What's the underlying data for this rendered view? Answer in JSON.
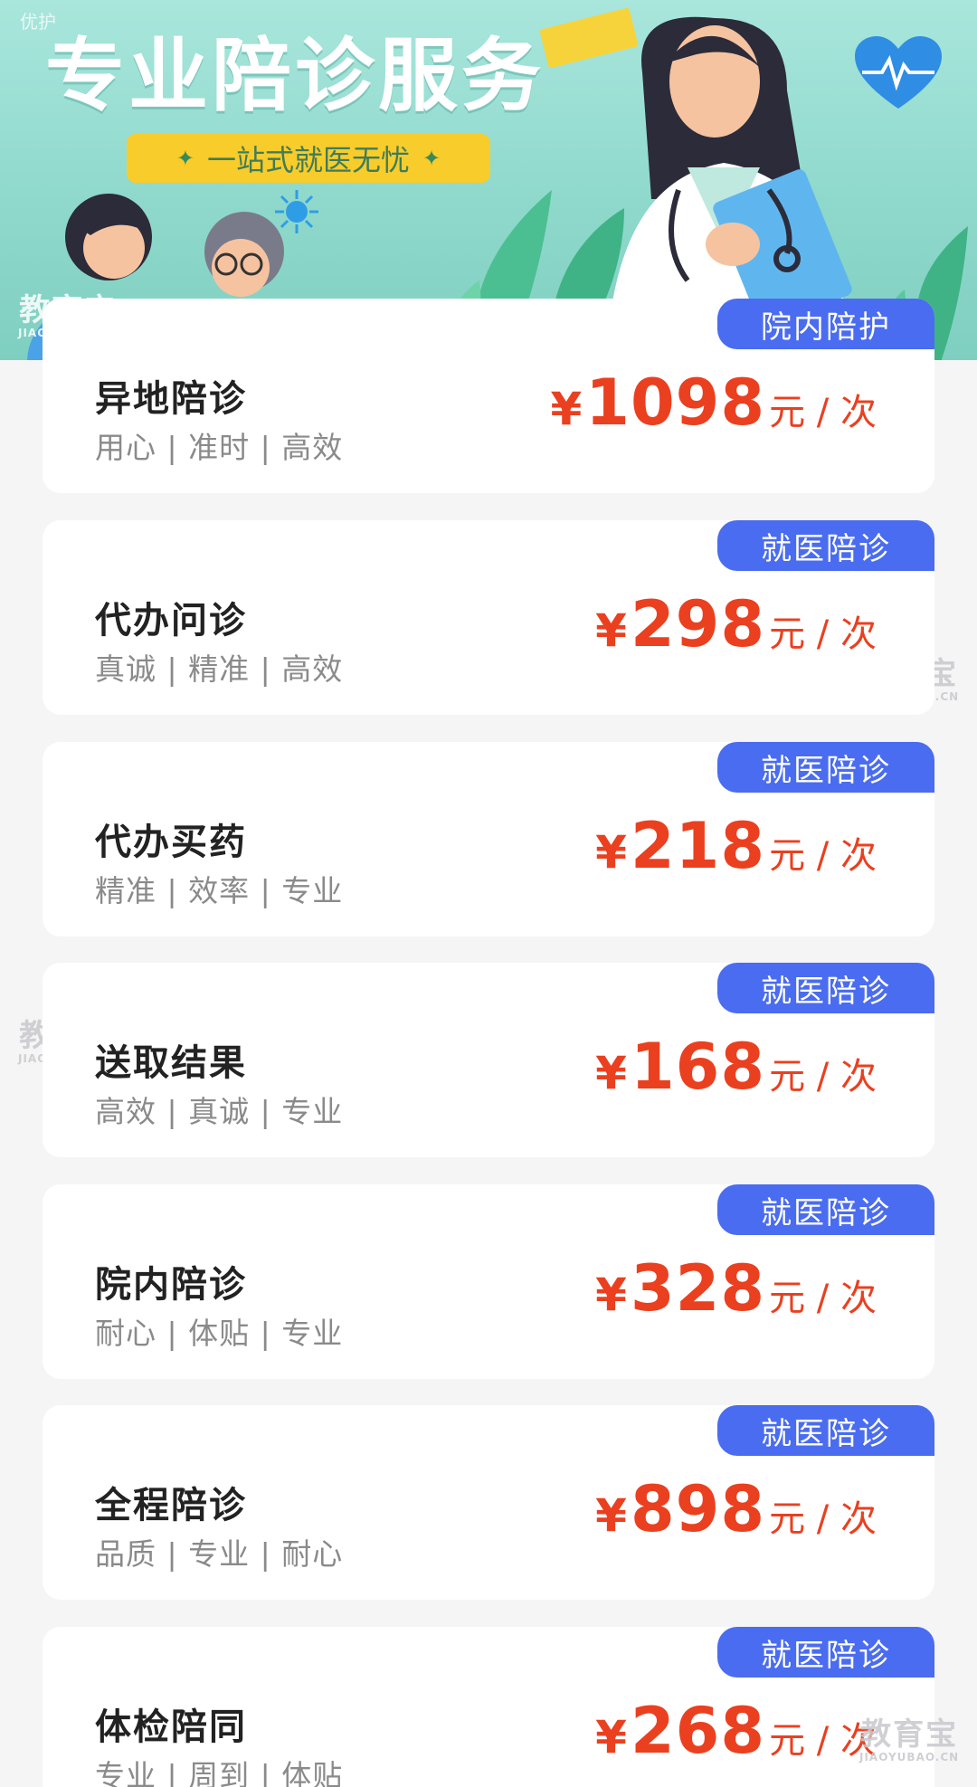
{
  "banner": {
    "corner_text": "优护",
    "title": "专业陪诊服务",
    "slogan": "一站式就医无忧",
    "colors": {
      "background": "#a9e6dc",
      "slogan_bg": "#f8cc2a",
      "heart": "#2f8de4"
    }
  },
  "watermark": {
    "main": "教育宝",
    "sub": "JIAOYUBAO.CN"
  },
  "price_prefix": "¥",
  "services": [
    {
      "name": "异地陪诊",
      "tags": "用心 | 准时 | 高效",
      "price": "1098",
      "unit": "元 / 次",
      "badge": "院内陪护"
    },
    {
      "name": "代办问诊",
      "tags": "真诚 | 精准 | 高效",
      "price": "298",
      "unit": "元 / 次",
      "badge": "就医陪诊"
    },
    {
      "name": "代办买药",
      "tags": "精准 | 效率 | 专业",
      "price": "218",
      "unit": "元 / 次",
      "badge": "就医陪诊"
    },
    {
      "name": "送取结果",
      "tags": "高效 | 真诚 | 专业",
      "price": "168",
      "unit": "元 / 次",
      "badge": "就医陪诊"
    },
    {
      "name": "院内陪诊",
      "tags": "耐心 | 体贴 | 专业",
      "price": "328",
      "unit": "元 / 次",
      "badge": "就医陪诊"
    },
    {
      "name": "全程陪诊",
      "tags": "品质 | 专业 | 耐心",
      "price": "898",
      "unit": "元 / 次",
      "badge": "就医陪诊"
    },
    {
      "name": "体检陪同",
      "tags": "专业 | 周到 | 体贴",
      "price": "268",
      "unit": "元 / 次",
      "badge": "就医陪诊"
    }
  ],
  "colors": {
    "price": "#ea4020",
    "badge": "#4a6cf0",
    "page_bg": "#f5f5f6"
  }
}
